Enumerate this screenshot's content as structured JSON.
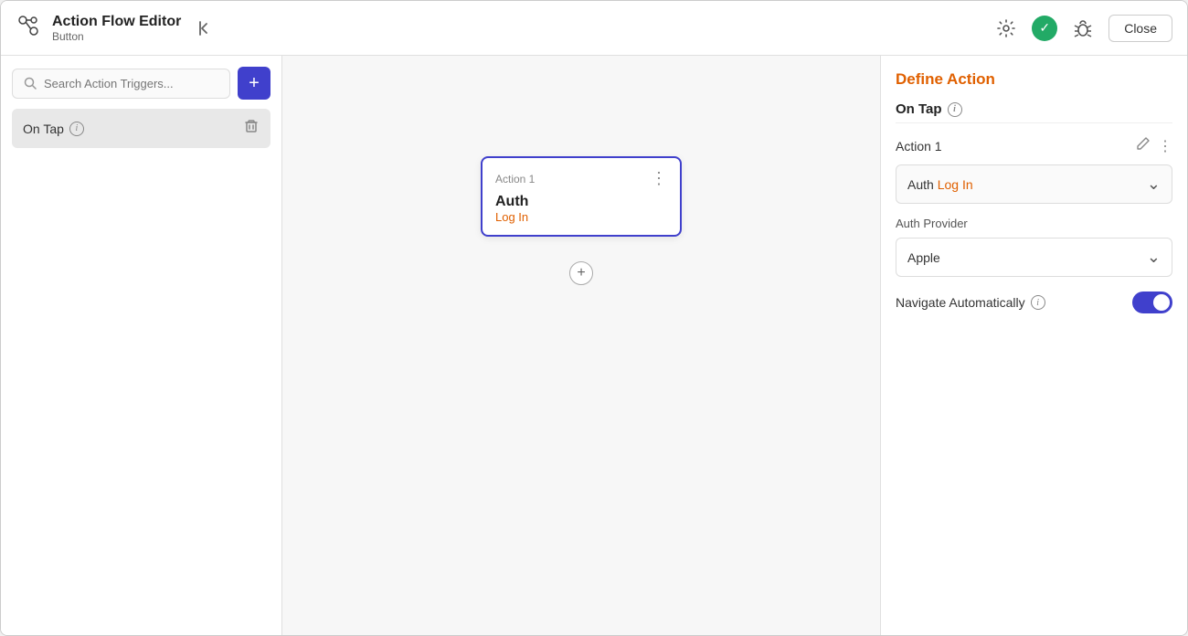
{
  "header": {
    "title": "Action Flow Editor",
    "subtitle": "Button",
    "collapse_btn": "◀",
    "close_label": "Close"
  },
  "sidebar": {
    "search_placeholder": "Search Action Triggers...",
    "add_btn_label": "+",
    "trigger": {
      "label": "On Tap",
      "delete_icon": "🗑"
    }
  },
  "canvas": {
    "action_card": {
      "header_label": "Action 1",
      "name": "Auth",
      "sub": "Log In",
      "add_btn": "+"
    }
  },
  "right_panel": {
    "title": "Define Action",
    "trigger_label": "On Tap",
    "action_label": "Action 1",
    "dropdown": {
      "text_plain": "Auth",
      "text_orange": "Log In"
    },
    "auth_provider_label": "Auth Provider",
    "auth_provider_value": "Apple",
    "navigate_label": "Navigate Automatically",
    "toggle_enabled": true
  }
}
